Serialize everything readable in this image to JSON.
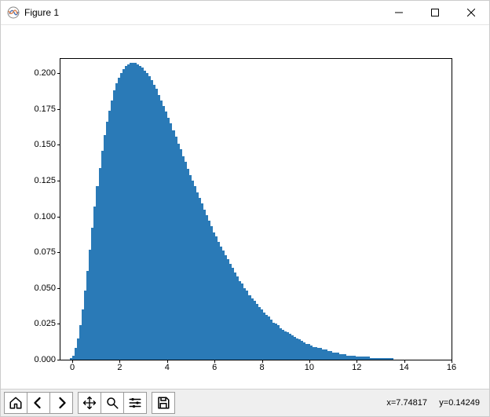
{
  "window": {
    "title": "Figure 1"
  },
  "toolbar": {
    "coord_text": "x=7.74817     y=0.14249"
  },
  "chart_data": {
    "type": "bar",
    "title": "",
    "xlabel": "",
    "ylabel": "",
    "xlim": [
      -0.5,
      16
    ],
    "ylim": [
      0,
      0.21
    ],
    "xticks": [
      0,
      2,
      4,
      6,
      8,
      10,
      12,
      14,
      16
    ],
    "yticks": [
      0.0,
      0.025,
      0.05,
      0.075,
      0.1,
      0.125,
      0.15,
      0.175,
      0.2
    ],
    "colors": {
      "bar": "#2a7ab7"
    },
    "x": [
      -0.4,
      -0.3,
      -0.2,
      -0.1,
      0.0,
      0.1,
      0.2,
      0.3,
      0.4,
      0.5,
      0.6,
      0.7,
      0.8,
      0.9,
      1.0,
      1.1,
      1.2,
      1.3,
      1.4,
      1.5,
      1.6,
      1.7,
      1.8,
      1.9,
      2.0,
      2.1,
      2.2,
      2.3,
      2.4,
      2.5,
      2.6,
      2.7,
      2.8,
      2.9,
      3.0,
      3.1,
      3.2,
      3.3,
      3.4,
      3.5,
      3.6,
      3.7,
      3.8,
      3.9,
      4.0,
      4.1,
      4.2,
      4.3,
      4.4,
      4.5,
      4.6,
      4.7,
      4.8,
      4.9,
      5.0,
      5.1,
      5.2,
      5.3,
      5.4,
      5.5,
      5.6,
      5.7,
      5.8,
      5.9,
      6.0,
      6.1,
      6.2,
      6.3,
      6.4,
      6.5,
      6.6,
      6.7,
      6.8,
      6.9,
      7.0,
      7.1,
      7.2,
      7.3,
      7.4,
      7.5,
      7.6,
      7.7,
      7.8,
      7.9,
      8.0,
      8.1,
      8.2,
      8.3,
      8.4,
      8.5,
      8.6,
      8.7,
      8.8,
      8.9,
      9.0,
      9.1,
      9.2,
      9.3,
      9.4,
      9.5,
      9.6,
      9.7,
      9.8,
      9.9,
      10.0,
      10.1,
      10.2,
      10.3,
      10.4,
      10.5,
      10.6,
      10.7,
      10.8,
      10.9,
      11.0,
      11.1,
      11.2,
      11.3,
      11.4,
      11.5,
      11.6,
      11.7,
      11.8,
      11.9,
      12.0,
      12.1,
      12.2,
      12.3,
      12.4,
      12.5,
      12.6,
      12.7,
      12.8,
      12.9,
      13.0,
      13.1,
      13.2,
      13.3,
      13.4,
      13.5,
      13.6,
      13.7,
      13.8,
      13.9,
      14.0,
      14.1,
      14.2,
      14.3,
      14.4,
      14.5,
      14.6,
      14.7,
      14.8,
      14.9,
      15.0,
      15.1,
      15.2,
      15.3,
      15.4,
      15.5,
      15.6,
      15.7,
      15.8,
      15.9
    ],
    "values": [
      0.0,
      0.0,
      0.0,
      0.0,
      0.001,
      0.003,
      0.008,
      0.015,
      0.024,
      0.035,
      0.048,
      0.062,
      0.077,
      0.092,
      0.107,
      0.121,
      0.134,
      0.146,
      0.157,
      0.166,
      0.174,
      0.181,
      0.188,
      0.193,
      0.197,
      0.2,
      0.203,
      0.205,
      0.206,
      0.207,
      0.207,
      0.207,
      0.206,
      0.205,
      0.204,
      0.202,
      0.2,
      0.198,
      0.195,
      0.192,
      0.189,
      0.185,
      0.181,
      0.177,
      0.173,
      0.169,
      0.165,
      0.16,
      0.156,
      0.151,
      0.147,
      0.142,
      0.138,
      0.133,
      0.129,
      0.125,
      0.121,
      0.117,
      0.113,
      0.109,
      0.105,
      0.101,
      0.097,
      0.093,
      0.089,
      0.086,
      0.082,
      0.079,
      0.076,
      0.073,
      0.07,
      0.067,
      0.064,
      0.061,
      0.058,
      0.055,
      0.053,
      0.05,
      0.048,
      0.045,
      0.043,
      0.041,
      0.039,
      0.037,
      0.035,
      0.033,
      0.031,
      0.03,
      0.028,
      0.026,
      0.025,
      0.024,
      0.022,
      0.021,
      0.02,
      0.019,
      0.018,
      0.017,
      0.016,
      0.015,
      0.014,
      0.013,
      0.012,
      0.011,
      0.011,
      0.01,
      0.009,
      0.009,
      0.008,
      0.008,
      0.007,
      0.007,
      0.006,
      0.006,
      0.005,
      0.005,
      0.005,
      0.004,
      0.004,
      0.004,
      0.003,
      0.003,
      0.003,
      0.003,
      0.002,
      0.002,
      0.002,
      0.002,
      0.002,
      0.002,
      0.001,
      0.001,
      0.001,
      0.001,
      0.001,
      0.001,
      0.001,
      0.001,
      0.001,
      0.001,
      0.0,
      0.0,
      0.0,
      0.0,
      0.0,
      0.0,
      0.0,
      0.0,
      0.0,
      0.0,
      0.0,
      0.0,
      0.0,
      0.0,
      0.0,
      0.0,
      0.0,
      0.0,
      0.0,
      0.0,
      0.0,
      0.0,
      0.0,
      0.0
    ]
  }
}
